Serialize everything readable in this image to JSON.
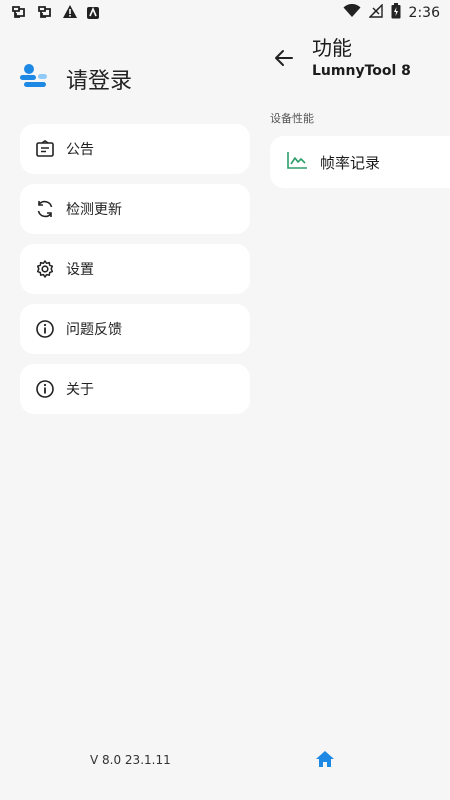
{
  "status_bar": {
    "left_icons": [
      "bug-icon",
      "bug-icon",
      "warning-icon",
      "app-notification-icon"
    ],
    "right_icons": [
      "wifi-icon",
      "signal-icon",
      "battery-icon"
    ],
    "time": "2:36"
  },
  "drawer": {
    "login_label": "请登录",
    "menu": [
      {
        "label": "公告",
        "icon": "announcement-icon"
      },
      {
        "label": "检测更新",
        "icon": "refresh-icon"
      },
      {
        "label": "设置",
        "icon": "gear-icon"
      },
      {
        "label": "问题反馈",
        "icon": "info-icon"
      },
      {
        "label": "关于",
        "icon": "info-icon"
      }
    ],
    "version": "V 8.0 23.1.11"
  },
  "content": {
    "title": "功能",
    "subtitle": "LumnyTool 8",
    "section_title": "设备性能",
    "features": [
      {
        "label": "帧率记录",
        "icon": "line-chart-icon"
      }
    ]
  },
  "colors": {
    "accent": "#1e88e5",
    "chart_green": "#2e9e6a",
    "background": "#f6f6f6",
    "card": "#ffffff"
  }
}
